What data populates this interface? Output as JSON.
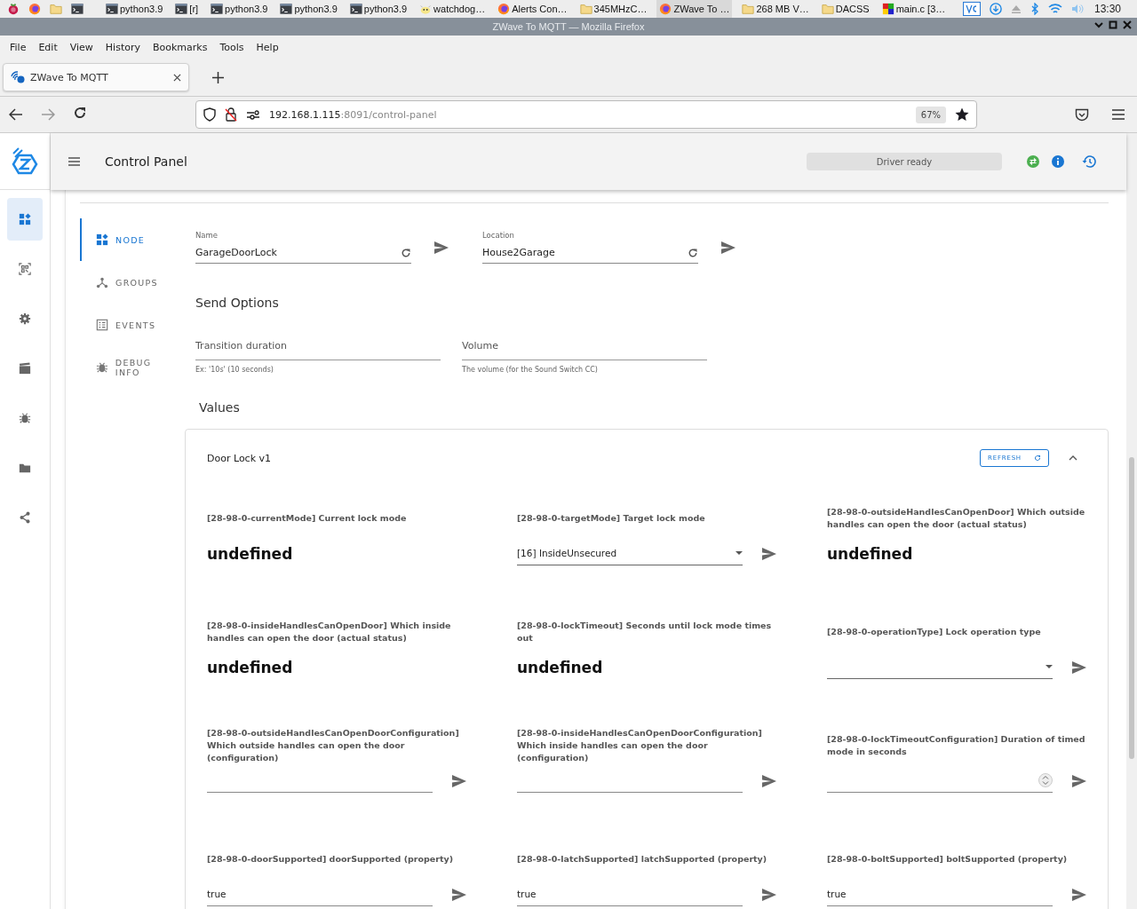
{
  "taskbar": {
    "launchers": [
      {
        "kind": "raspberry"
      },
      {
        "kind": "firefox"
      },
      {
        "kind": "folder"
      },
      {
        "kind": "terminal"
      }
    ],
    "tasks": [
      {
        "label": "python3.9",
        "kind": "terminal",
        "selected": false
      },
      {
        "label": "[r]",
        "kind": "terminal",
        "selected": false
      },
      {
        "label": "python3.9",
        "kind": "terminal",
        "selected": false
      },
      {
        "label": "python3.9",
        "kind": "terminal",
        "selected": false
      },
      {
        "label": "python3.9",
        "kind": "terminal",
        "selected": false
      },
      {
        "label": "watchdog…",
        "kind": "cow",
        "selected": false
      },
      {
        "label": "Alerts Con…",
        "kind": "firefox",
        "selected": false
      },
      {
        "label": "345MHzC…",
        "kind": "folder",
        "selected": false
      },
      {
        "label": "ZWave To …",
        "kind": "firefox",
        "selected": true
      },
      {
        "label": "268 MB V…",
        "kind": "folder",
        "selected": false
      },
      {
        "label": "DACSS",
        "kind": "folder",
        "selected": false
      },
      {
        "label": "main.c [3…",
        "kind": "blocks",
        "selected": false
      }
    ],
    "clock": "13:30"
  },
  "window": {
    "title": "ZWave To MQTT — Mozilla Firefox"
  },
  "menu": [
    "File",
    "Edit",
    "View",
    "History",
    "Bookmarks",
    "Tools",
    "Help"
  ],
  "tabs": [
    {
      "title": "ZWave To MQTT",
      "selected": true
    }
  ],
  "address": {
    "host": "192.168.1.115",
    "path": ":8091/control-panel",
    "zoom": "67%"
  },
  "app": {
    "title": "Control Panel",
    "status": "Driver ready",
    "nav": [
      {
        "kind": "dashboard",
        "selected": true
      },
      {
        "kind": "scan",
        "selected": false
      },
      {
        "kind": "settings",
        "selected": false
      },
      {
        "kind": "scenes",
        "selected": false
      },
      {
        "kind": "debug",
        "selected": false
      },
      {
        "kind": "folder",
        "selected": false
      },
      {
        "kind": "share",
        "selected": false
      }
    ]
  },
  "node_tabs": [
    {
      "label": "NODE",
      "kind": "node",
      "selected": true
    },
    {
      "label": "GROUPS",
      "kind": "groups",
      "selected": false
    },
    {
      "label": "EVENTS",
      "kind": "events",
      "selected": false
    },
    {
      "label": "DEBUG INFO",
      "kind": "debug",
      "selected": false
    }
  ],
  "node_fields": [
    {
      "label": "Name",
      "value": "GarageDoorLock"
    },
    {
      "label": "Location",
      "value": "House2Garage"
    }
  ],
  "send_options": {
    "heading": "Send Options",
    "fields": [
      {
        "placeholder": "Transition duration",
        "hint": "Ex: '10s' (10 seconds)"
      },
      {
        "placeholder": "Volume",
        "hint": "The volume (for the Sound Switch CC)"
      }
    ]
  },
  "values": {
    "heading": "Values",
    "card": {
      "title": "Door Lock v1",
      "refresh": "REFRESH",
      "expanded": true,
      "items": [
        {
          "label": "[28-98-0-currentMode] Current lock mode",
          "kind": "readonly",
          "value": "undefined"
        },
        {
          "label": "[28-98-0-targetMode] Target lock mode",
          "kind": "select",
          "value": "[16] InsideUnsecured"
        },
        {
          "label": "[28-98-0-outsideHandlesCanOpenDoor] Which outside handles can open the door (actual status)",
          "kind": "readonly",
          "value": "undefined"
        },
        {
          "label": "[28-98-0-insideHandlesCanOpenDoor] Which inside handles can open the door (actual status)",
          "kind": "readonly",
          "value": "undefined"
        },
        {
          "label": "[28-98-0-lockTimeout] Seconds until lock mode times out",
          "kind": "readonly",
          "value": "undefined"
        },
        {
          "label": "[28-98-0-operationType] Lock operation type",
          "kind": "select"
        },
        {
          "label": "[28-98-0-outsideHandlesCanOpenDoorConfiguration] Which outside handles can open the door (configuration)",
          "kind": "input"
        },
        {
          "label": "[28-98-0-insideHandlesCanOpenDoorConfiguration] Which inside handles can open the door (configuration)",
          "kind": "input"
        },
        {
          "label": "[28-98-0-lockTimeoutConfiguration] Duration of timed mode in seconds",
          "kind": "number"
        },
        {
          "label": "[28-98-0-doorSupported] doorSupported (property)",
          "kind": "input",
          "value": "true"
        },
        {
          "label": "[28-98-0-latchSupported] latchSupported (property)",
          "kind": "input",
          "value": "true"
        },
        {
          "label": "[28-98-0-boltSupported] boltSupported (property)",
          "kind": "input",
          "value": "true"
        }
      ]
    }
  }
}
